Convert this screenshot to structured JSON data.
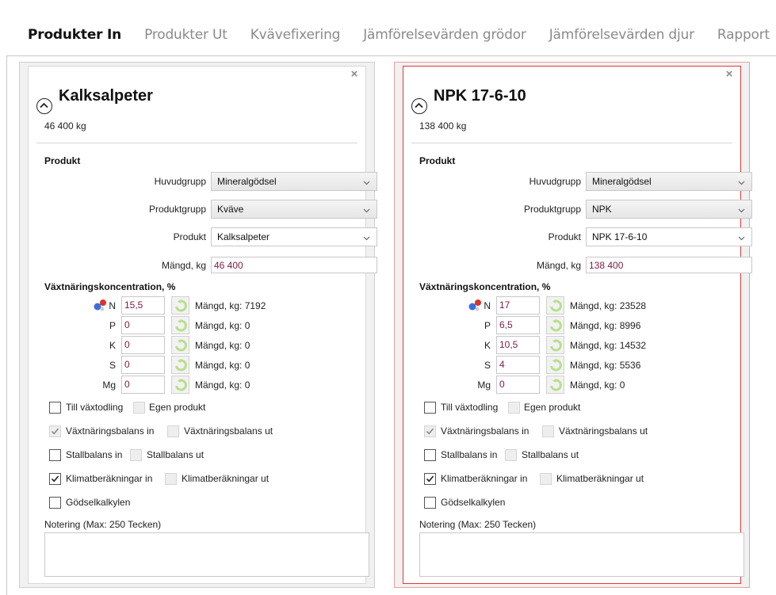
{
  "tabs": [
    {
      "label": "Produkter In",
      "active": true
    },
    {
      "label": "Produkter Ut",
      "active": false
    },
    {
      "label": "Kvävefixering",
      "active": false
    },
    {
      "label": "Jämförelsevärden grödor",
      "active": false
    },
    {
      "label": "Jämförelsevärden djur",
      "active": false
    },
    {
      "label": "Rapport",
      "active": false
    }
  ],
  "labels": {
    "section_product": "Produkt",
    "huvudgrupp": "Huvudgrupp",
    "produktgrupp": "Produktgrupp",
    "produkt": "Produkt",
    "mangd_kg": "Mängd, kg",
    "section_nutrients": "Växtnäringskoncentration, %",
    "cb_till_vaxtodling": "Till växtodling",
    "cb_egen_produkt": "Egen produkt",
    "cb_vaxt_in": "Växtnäringsbalans in",
    "cb_vaxt_ut": "Växtnäringsbalans ut",
    "cb_stall_in": "Stallbalans in",
    "cb_stall_ut": "Stallbalans ut",
    "cb_klimat_in": "Klimatberäkningar in",
    "cb_klimat_ut": "Klimatberäkningar ut",
    "cb_godsel": "Gödselkalkylen",
    "notes_label": "Notering (Max: 250 Tecken)",
    "close_symbol": "×"
  },
  "panels": [
    {
      "name": "Kalksalpeter",
      "amount": "46 400 kg",
      "huvudgrupp": "Mineralgödsel",
      "produktgrupp": "Kväve",
      "produkt": "Kalksalpeter",
      "mangd": "46 400",
      "nutrients": [
        {
          "label": "N",
          "value": "15,5",
          "mangd": "Mängd, kg: 7192"
        },
        {
          "label": "P",
          "value": "0",
          "mangd": "Mängd, kg: 0"
        },
        {
          "label": "K",
          "value": "0",
          "mangd": "Mängd, kg: 0"
        },
        {
          "label": "S",
          "value": "0",
          "mangd": "Mängd, kg: 0"
        },
        {
          "label": "Mg",
          "value": "0",
          "mangd": "Mängd, kg: 0"
        }
      ],
      "checkboxes": {
        "till_vaxtodling": false,
        "egen_produkt": false,
        "vaxt_in": true,
        "vaxt_ut": false,
        "stall_in": false,
        "stall_ut": false,
        "klimat_in": true,
        "klimat_ut": false,
        "godsel": false
      },
      "notes": ""
    },
    {
      "name": "NPK 17-6-10",
      "amount": "138 400 kg",
      "huvudgrupp": "Mineralgödsel",
      "produktgrupp": "NPK",
      "produkt": "NPK 17-6-10",
      "mangd": "138 400",
      "nutrients": [
        {
          "label": "N",
          "value": "17",
          "mangd": "Mängd, kg: 23528"
        },
        {
          "label": "P",
          "value": "6,5",
          "mangd": "Mängd, kg: 8996"
        },
        {
          "label": "K",
          "value": "10,5",
          "mangd": "Mängd, kg: 14532"
        },
        {
          "label": "S",
          "value": "4",
          "mangd": "Mängd, kg: 5536"
        },
        {
          "label": "Mg",
          "value": "0",
          "mangd": "Mängd, kg: 0"
        }
      ],
      "checkboxes": {
        "till_vaxtodling": false,
        "egen_produkt": false,
        "vaxt_in": true,
        "vaxt_ut": false,
        "stall_in": false,
        "stall_ut": false,
        "klimat_in": true,
        "klimat_ut": false,
        "godsel": false
      },
      "notes": ""
    }
  ],
  "icons": {
    "close": "close-icon",
    "collapse": "chevron-up-circle-icon",
    "dropdown": "chevron-down-icon",
    "atom": "molecule-icon",
    "refresh": "refresh-icon",
    "check": "check-icon"
  },
  "colors": {
    "selected_border": "#e23a3a",
    "input_value_text": "#7a1f3c",
    "refresh_icon": "#b7e08a"
  }
}
